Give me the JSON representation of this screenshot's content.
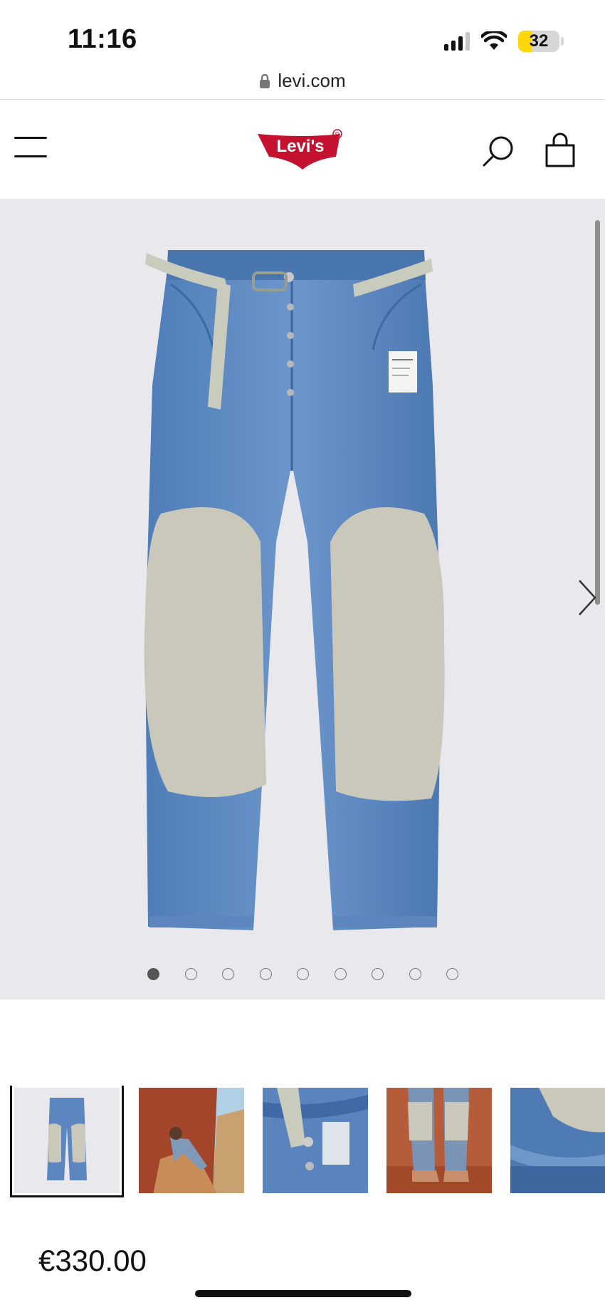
{
  "status_bar": {
    "time": "11:16",
    "battery_level": "32",
    "icons": [
      "cellular-signal-icon",
      "wifi-icon",
      "battery-icon"
    ]
  },
  "browser": {
    "url": "levi.com",
    "lock_icon": "lock-icon"
  },
  "header": {
    "menu_icon": "hamburger-menu-icon",
    "logo_text": "Levi's",
    "search_icon": "search-icon",
    "bag_icon": "shopping-bag-icon"
  },
  "gallery": {
    "image_count": 9,
    "active_index": 0,
    "next_icon": "chevron-right-icon"
  },
  "thumbnails": [
    {
      "name": "thumb-product-front",
      "selected": true
    },
    {
      "name": "thumb-model-rocks",
      "selected": false
    },
    {
      "name": "thumb-detail-waist",
      "selected": false
    },
    {
      "name": "thumb-model-legs",
      "selected": false
    },
    {
      "name": "thumb-detail-hem",
      "selected": false
    }
  ],
  "product": {
    "price": "€330.00"
  },
  "colors": {
    "brand_red": "#c41230",
    "gallery_bg": "#e9e9ed",
    "denim": "#5b86bf",
    "patch": "#c9c8bb"
  }
}
